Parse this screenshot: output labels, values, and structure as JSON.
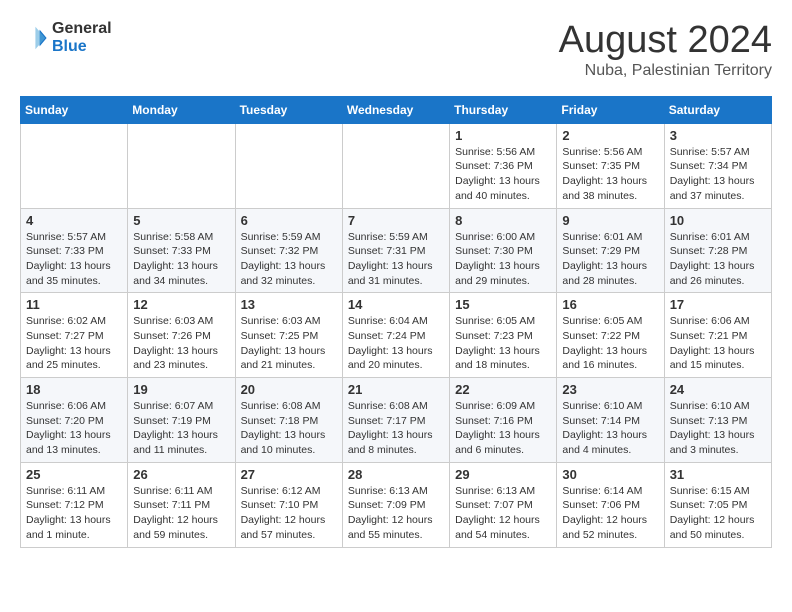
{
  "logo": {
    "general": "General",
    "blue": "Blue"
  },
  "title": "August 2024",
  "subtitle": "Nuba, Palestinian Territory",
  "headers": [
    "Sunday",
    "Monday",
    "Tuesday",
    "Wednesday",
    "Thursday",
    "Friday",
    "Saturday"
  ],
  "weeks": [
    [
      {
        "day": "",
        "info": ""
      },
      {
        "day": "",
        "info": ""
      },
      {
        "day": "",
        "info": ""
      },
      {
        "day": "",
        "info": ""
      },
      {
        "day": "1",
        "info": "Sunrise: 5:56 AM\nSunset: 7:36 PM\nDaylight: 13 hours\nand 40 minutes."
      },
      {
        "day": "2",
        "info": "Sunrise: 5:56 AM\nSunset: 7:35 PM\nDaylight: 13 hours\nand 38 minutes."
      },
      {
        "day": "3",
        "info": "Sunrise: 5:57 AM\nSunset: 7:34 PM\nDaylight: 13 hours\nand 37 minutes."
      }
    ],
    [
      {
        "day": "4",
        "info": "Sunrise: 5:57 AM\nSunset: 7:33 PM\nDaylight: 13 hours\nand 35 minutes."
      },
      {
        "day": "5",
        "info": "Sunrise: 5:58 AM\nSunset: 7:33 PM\nDaylight: 13 hours\nand 34 minutes."
      },
      {
        "day": "6",
        "info": "Sunrise: 5:59 AM\nSunset: 7:32 PM\nDaylight: 13 hours\nand 32 minutes."
      },
      {
        "day": "7",
        "info": "Sunrise: 5:59 AM\nSunset: 7:31 PM\nDaylight: 13 hours\nand 31 minutes."
      },
      {
        "day": "8",
        "info": "Sunrise: 6:00 AM\nSunset: 7:30 PM\nDaylight: 13 hours\nand 29 minutes."
      },
      {
        "day": "9",
        "info": "Sunrise: 6:01 AM\nSunset: 7:29 PM\nDaylight: 13 hours\nand 28 minutes."
      },
      {
        "day": "10",
        "info": "Sunrise: 6:01 AM\nSunset: 7:28 PM\nDaylight: 13 hours\nand 26 minutes."
      }
    ],
    [
      {
        "day": "11",
        "info": "Sunrise: 6:02 AM\nSunset: 7:27 PM\nDaylight: 13 hours\nand 25 minutes."
      },
      {
        "day": "12",
        "info": "Sunrise: 6:03 AM\nSunset: 7:26 PM\nDaylight: 13 hours\nand 23 minutes."
      },
      {
        "day": "13",
        "info": "Sunrise: 6:03 AM\nSunset: 7:25 PM\nDaylight: 13 hours\nand 21 minutes."
      },
      {
        "day": "14",
        "info": "Sunrise: 6:04 AM\nSunset: 7:24 PM\nDaylight: 13 hours\nand 20 minutes."
      },
      {
        "day": "15",
        "info": "Sunrise: 6:05 AM\nSunset: 7:23 PM\nDaylight: 13 hours\nand 18 minutes."
      },
      {
        "day": "16",
        "info": "Sunrise: 6:05 AM\nSunset: 7:22 PM\nDaylight: 13 hours\nand 16 minutes."
      },
      {
        "day": "17",
        "info": "Sunrise: 6:06 AM\nSunset: 7:21 PM\nDaylight: 13 hours\nand 15 minutes."
      }
    ],
    [
      {
        "day": "18",
        "info": "Sunrise: 6:06 AM\nSunset: 7:20 PM\nDaylight: 13 hours\nand 13 minutes."
      },
      {
        "day": "19",
        "info": "Sunrise: 6:07 AM\nSunset: 7:19 PM\nDaylight: 13 hours\nand 11 minutes."
      },
      {
        "day": "20",
        "info": "Sunrise: 6:08 AM\nSunset: 7:18 PM\nDaylight: 13 hours\nand 10 minutes."
      },
      {
        "day": "21",
        "info": "Sunrise: 6:08 AM\nSunset: 7:17 PM\nDaylight: 13 hours\nand 8 minutes."
      },
      {
        "day": "22",
        "info": "Sunrise: 6:09 AM\nSunset: 7:16 PM\nDaylight: 13 hours\nand 6 minutes."
      },
      {
        "day": "23",
        "info": "Sunrise: 6:10 AM\nSunset: 7:14 PM\nDaylight: 13 hours\nand 4 minutes."
      },
      {
        "day": "24",
        "info": "Sunrise: 6:10 AM\nSunset: 7:13 PM\nDaylight: 13 hours\nand 3 minutes."
      }
    ],
    [
      {
        "day": "25",
        "info": "Sunrise: 6:11 AM\nSunset: 7:12 PM\nDaylight: 13 hours\nand 1 minute."
      },
      {
        "day": "26",
        "info": "Sunrise: 6:11 AM\nSunset: 7:11 PM\nDaylight: 12 hours\nand 59 minutes."
      },
      {
        "day": "27",
        "info": "Sunrise: 6:12 AM\nSunset: 7:10 PM\nDaylight: 12 hours\nand 57 minutes."
      },
      {
        "day": "28",
        "info": "Sunrise: 6:13 AM\nSunset: 7:09 PM\nDaylight: 12 hours\nand 55 minutes."
      },
      {
        "day": "29",
        "info": "Sunrise: 6:13 AM\nSunset: 7:07 PM\nDaylight: 12 hours\nand 54 minutes."
      },
      {
        "day": "30",
        "info": "Sunrise: 6:14 AM\nSunset: 7:06 PM\nDaylight: 12 hours\nand 52 minutes."
      },
      {
        "day": "31",
        "info": "Sunrise: 6:15 AM\nSunset: 7:05 PM\nDaylight: 12 hours\nand 50 minutes."
      }
    ]
  ]
}
